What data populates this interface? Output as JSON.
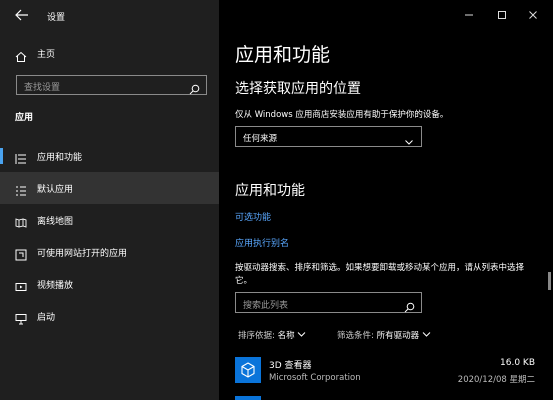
{
  "window": {
    "title": "设置"
  },
  "sidebar": {
    "home_label": "主页",
    "search_placeholder": "查找设置",
    "section_label": "应用",
    "items": [
      {
        "label": "应用和功能",
        "icon": "apps-list-icon",
        "selected": true
      },
      {
        "label": "默认应用",
        "icon": "default-apps-icon",
        "hover": true
      },
      {
        "label": "离线地图",
        "icon": "map-icon"
      },
      {
        "label": "可使用网站打开的应用",
        "icon": "web-apps-icon"
      },
      {
        "label": "视频播放",
        "icon": "video-icon"
      },
      {
        "label": "启动",
        "icon": "startup-icon"
      }
    ]
  },
  "main": {
    "title": "应用和功能",
    "source_heading": "选择获取应用的位置",
    "source_desc": "仅从 Windows 应用商店安装应用有助于保护你的设备。",
    "source_value": "任何来源",
    "apps_heading": "应用和功能",
    "link_optional": "可选功能",
    "link_alias": "应用执行别名",
    "list_desc": "按驱动器搜索、排序和筛选。如果想要卸载或移动某个应用，请从列表中选择它。",
    "list_search_placeholder": "搜索此列表",
    "sort_label": "排序依据:",
    "sort_value": "名称",
    "filter_label": "筛选条件:",
    "filter_value": "所有驱动器",
    "apps": [
      {
        "name": "3D 查看器",
        "publisher": "Microsoft Corporation",
        "size": "16.0 KB",
        "date": "2020/12/08 星期二"
      }
    ]
  },
  "colors": {
    "accent": "#4aa3ef",
    "link": "#5aa8ff",
    "app_tile": "#0a74da"
  }
}
